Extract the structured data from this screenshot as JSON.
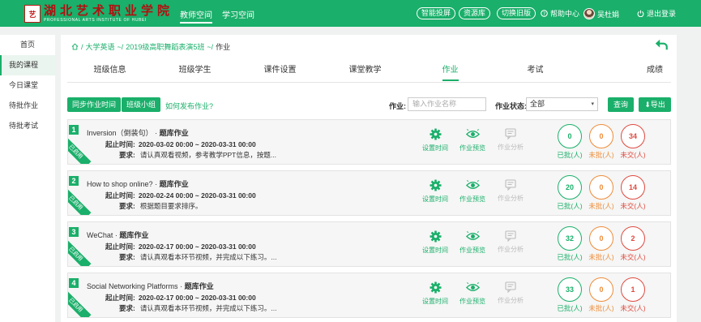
{
  "header": {
    "logo_cn": "湖北艺术职业学院",
    "logo_en": "PROFESSIONAL ARTS INSTITUTE OF HUBEI",
    "nav": [
      "教师空间",
      "学习空间"
    ],
    "pills": [
      "智能投屏",
      "资源库",
      "切换旧版"
    ],
    "help": "帮助中心",
    "user": "吴杜娟",
    "logout": "退出登录"
  },
  "sidebar": {
    "items": [
      "首页",
      "我的课程",
      "今日课堂",
      "待批作业",
      "待批考试"
    ]
  },
  "breadcrumb": [
    "大学英语",
    "2019级高职舞蹈表演5班",
    "作业"
  ],
  "tabs": [
    "班级信息",
    "班级学生",
    "课件设置",
    "课堂教学",
    "作业",
    "考试",
    "成绩"
  ],
  "toolbar": {
    "sync": "同步作业时间",
    "group": "班级小组",
    "howto": "如何发布作业?",
    "hw_label": "作业:",
    "hw_placeholder": "输入作业名称",
    "status_label": "作业状态:",
    "status_value": "全部",
    "search": "查询",
    "export": "导出"
  },
  "labels": {
    "time": "起止时间:",
    "req": "要求:",
    "type_sep": "·",
    "type": "题库作业",
    "act_time": "设置时间",
    "act_preview": "作业预览",
    "act_analysis": "作业分析",
    "graded": "已批(人)",
    "ungraded": "未批(人)",
    "unsubmitted": "未交(人)",
    "ribbon": "已启用"
  },
  "assignments": [
    {
      "num": "1",
      "name": "Inversion（倒装句）",
      "time": "2020-03-02 00:00 ~ 2020-03-31 00:00",
      "req": "请认真观看视频，参考教学PPT信息，按题...",
      "graded": "0",
      "ungraded": "0",
      "unsubmitted": "34"
    },
    {
      "num": "2",
      "name": "How to shop online?",
      "time": "2020-02-24 00:00 ~ 2020-03-31 00:00",
      "req": "根据题目要求排序。",
      "graded": "20",
      "ungraded": "0",
      "unsubmitted": "14"
    },
    {
      "num": "3",
      "name": "WeChat",
      "time": "2020-02-17 00:00 ~ 2020-03-31 00:00",
      "req": "请认真观看本环节视频，并完成以下练习。...",
      "graded": "32",
      "ungraded": "0",
      "unsubmitted": "2"
    },
    {
      "num": "4",
      "name": "Social Networking Platforms",
      "time": "2020-02-17 00:00 ~ 2020-03-31 00:00",
      "req": "请认真观看本环节视频，并完成以下练习。...",
      "graded": "33",
      "ungraded": "0",
      "unsubmitted": "1"
    }
  ],
  "colors": {
    "primary": "#1aaf6a",
    "orange": "#f08c3a",
    "red": "#e04a40"
  }
}
